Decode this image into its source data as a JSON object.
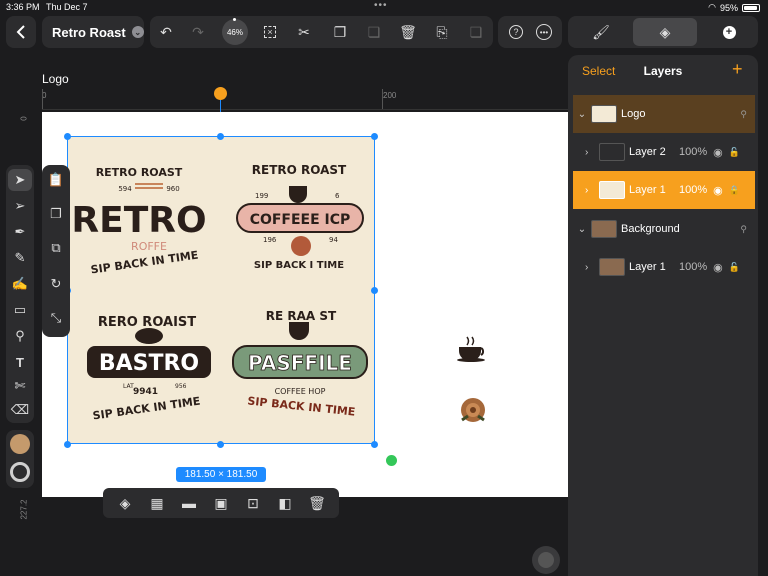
{
  "status": {
    "time": "3:36 PM",
    "date": "Thu Dec 7",
    "battery": "95%"
  },
  "toolbar": {
    "back_icon": "chevron-left-icon",
    "doc_title": "Retro Roast",
    "zoom": "46%"
  },
  "ruler": {
    "h_labels": [
      "0",
      "200"
    ],
    "v_labels": [
      "0",
      "227.2"
    ]
  },
  "canvas": {
    "label": "Logo",
    "selection_size": "181.50 × 181.50"
  },
  "artwork": {
    "tl": {
      "top": "RETRO ROAST",
      "n1": "594",
      "n2": "960",
      "main": "RETRO",
      "sub": "ROFFE",
      "bottom": "SIP BACK IN TIME"
    },
    "tr": {
      "top": "RETRO ROAST",
      "n1": "199",
      "n2": "6",
      "main": "COFFEEE ICP",
      "n3": "196",
      "n4": "94",
      "bottom": "SIP BACK I TIME"
    },
    "bl": {
      "top": "RERO ROAIST",
      "main": "BASTRO",
      "n1": "LAT",
      "n2": "9941",
      "n3": "956",
      "bottom": "SIP BACK IN TIME"
    },
    "br": {
      "top": "RE RAA ST",
      "main": "PASFFILE",
      "sub": "COFFEE HOP",
      "bottom": "SIP BACK IN TIME"
    }
  },
  "colors": {
    "accent": "#1e8bff",
    "orange": "#f7a01e",
    "swatch": "#c49a6c",
    "panel": "#2c2c2e",
    "logo_row": "#5a4020"
  },
  "layers_panel": {
    "select": "Select",
    "title": "Layers",
    "add": "+",
    "rows": [
      {
        "name": "Logo",
        "opacity": "",
        "kind": "group"
      },
      {
        "name": "Layer 2",
        "opacity": "100%",
        "kind": "layer"
      },
      {
        "name": "Layer 1",
        "opacity": "100%",
        "kind": "layer-selected"
      },
      {
        "name": "Background",
        "opacity": "",
        "kind": "group"
      },
      {
        "name": "Layer 1",
        "opacity": "100%",
        "kind": "layer"
      }
    ]
  }
}
